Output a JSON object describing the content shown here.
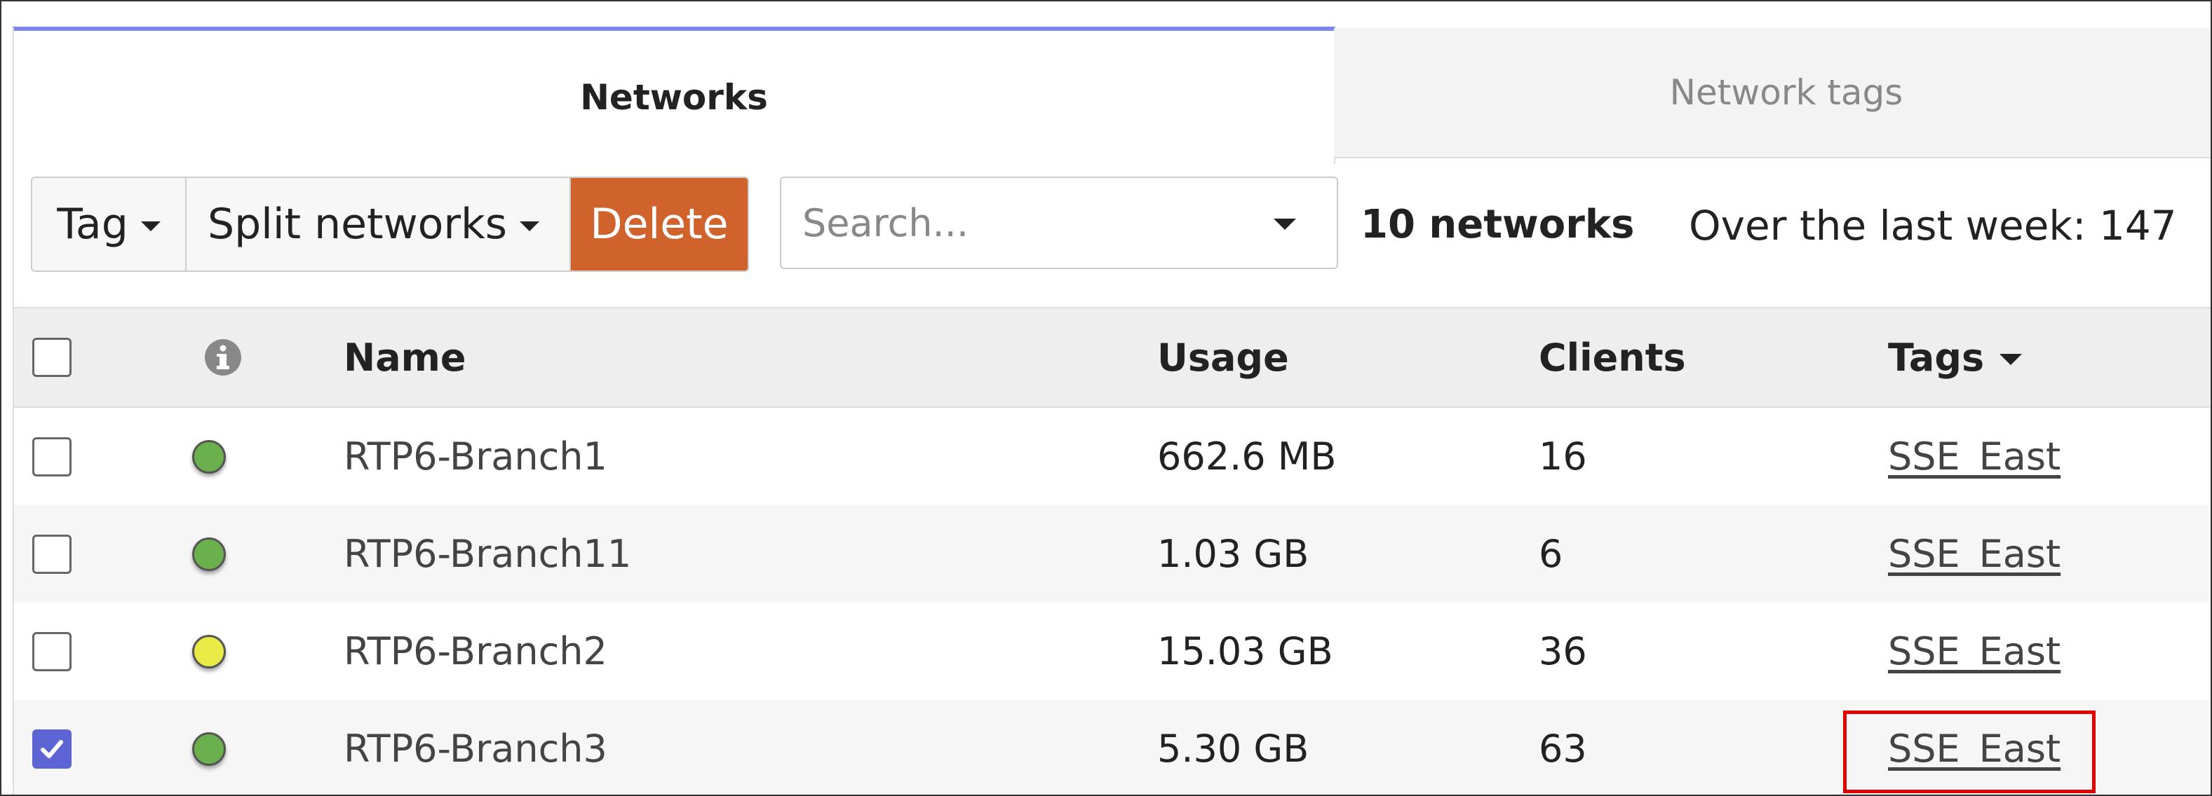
{
  "tabs": [
    {
      "label": "Networks",
      "active": true
    },
    {
      "label": "Network tags",
      "active": false
    }
  ],
  "toolbar": {
    "tag_label": "Tag",
    "split_label": "Split networks",
    "delete_label": "Delete",
    "delete_color": "#d0622c",
    "search_placeholder": "Search...",
    "count_text": "10 networks",
    "summary_text": "Over the last week: 147"
  },
  "table": {
    "headers": {
      "name": "Name",
      "usage": "Usage",
      "clients": "Clients",
      "tags": "Tags"
    },
    "rows": [
      {
        "name": "RTP6-Branch1",
        "usage": "662.6 MB",
        "clients": "16",
        "tag": "SSE_East",
        "status_color": "#6ab04c",
        "checked": false
      },
      {
        "name": "RTP6-Branch11",
        "usage": "1.03 GB",
        "clients": "6",
        "tag": "SSE_East",
        "status_color": "#6ab04c",
        "checked": false
      },
      {
        "name": "RTP6-Branch2",
        "usage": "15.03 GB",
        "clients": "36",
        "tag": "SSE_East",
        "status_color": "#e8ea46",
        "checked": false
      },
      {
        "name": "RTP6-Branch3",
        "usage": "5.30 GB",
        "clients": "63",
        "tag": "SSE_East",
        "status_color": "#6ab04c",
        "checked": true
      }
    ]
  },
  "colors": {
    "accent": "#7b86e8",
    "checkbox_checked": "#5d64d4",
    "highlight": "#e00000"
  }
}
